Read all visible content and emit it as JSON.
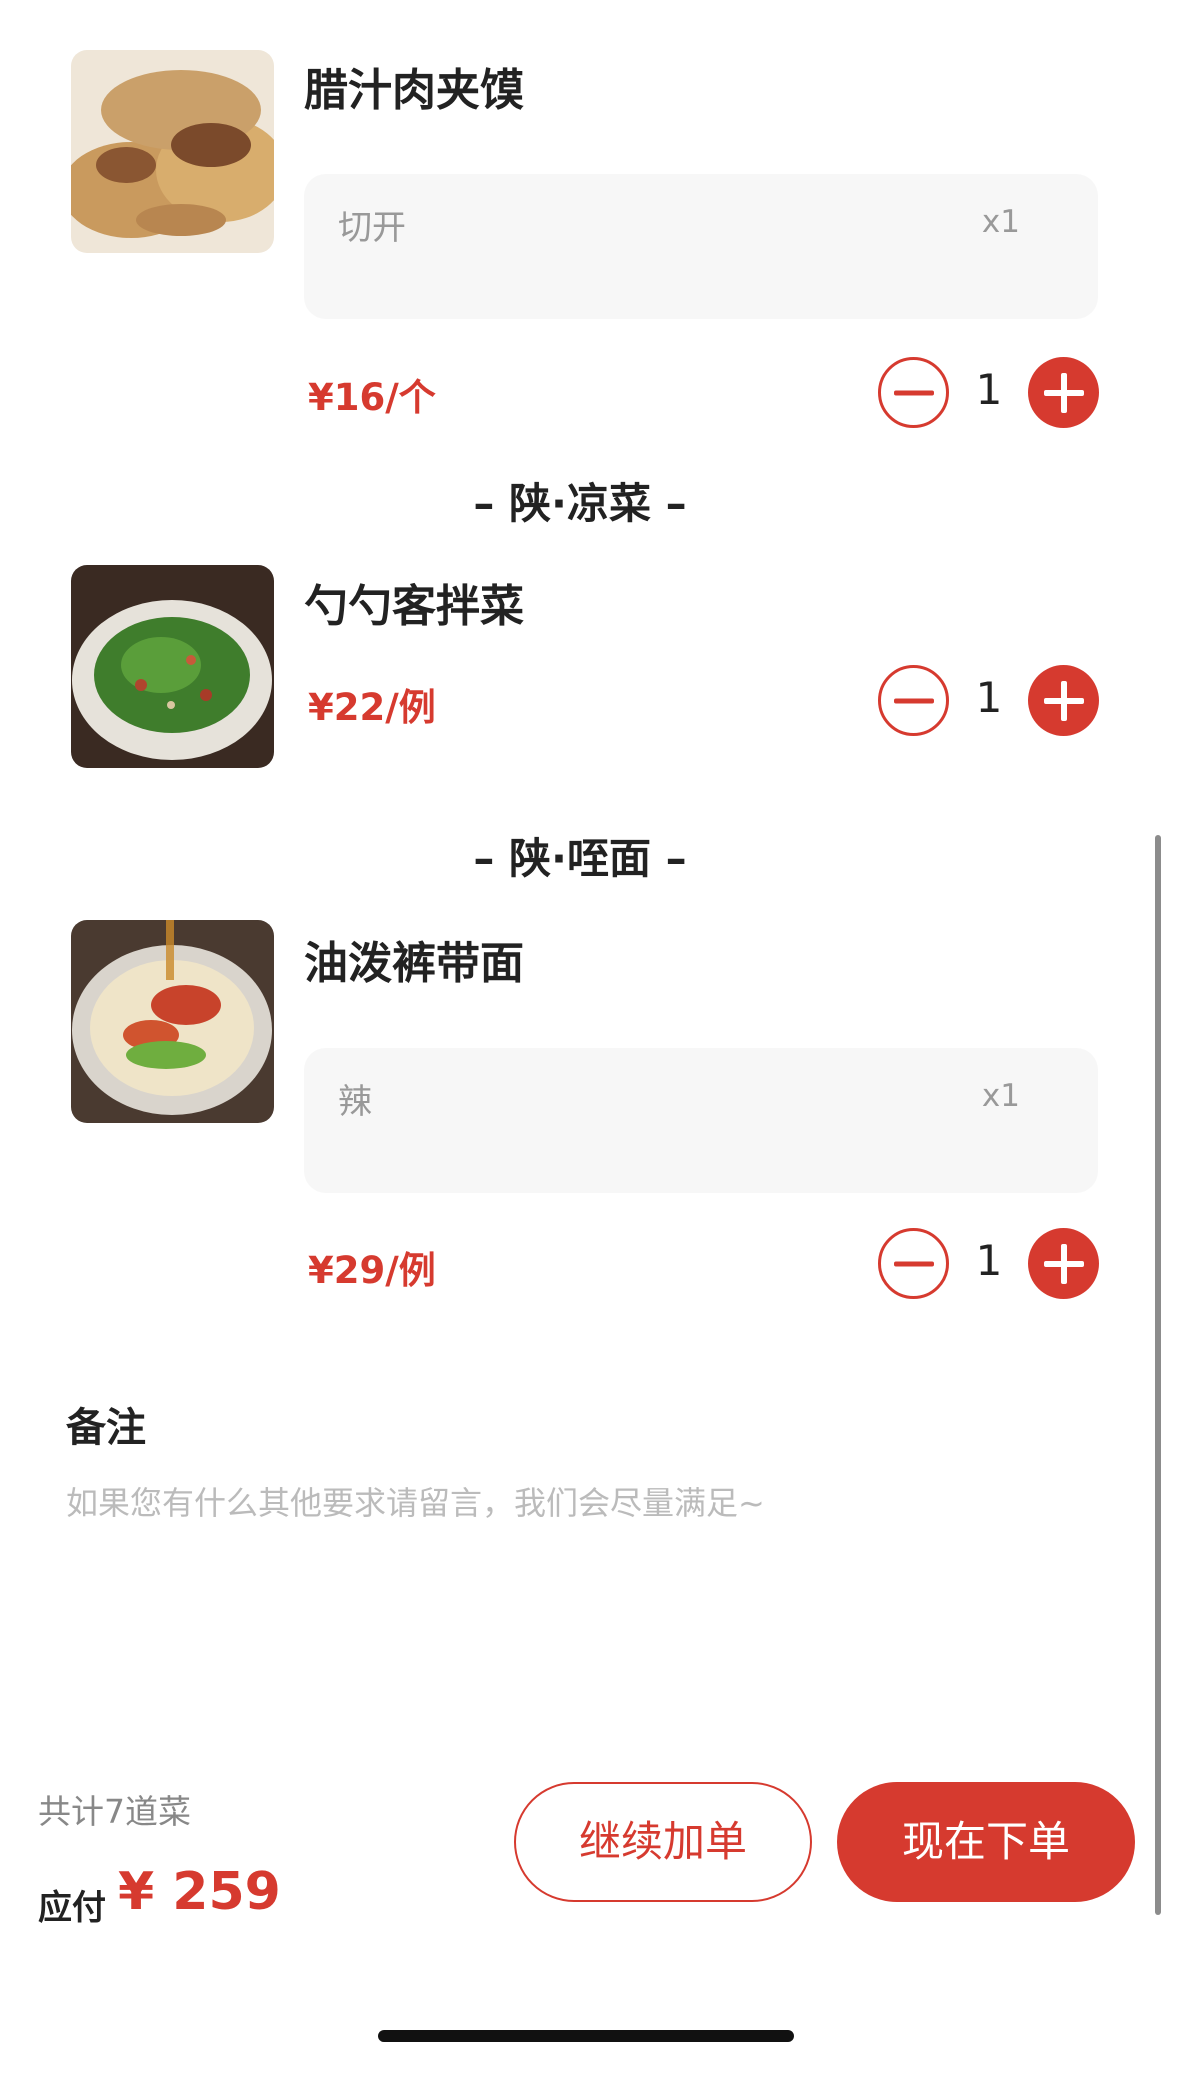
{
  "theme": {
    "accent": "#d63a2f",
    "text": "#222222",
    "muted": "#999999",
    "note_bg": "#f7f7f7"
  },
  "items": [
    {
      "name": "腊汁肉夹馍",
      "note": "切开",
      "note_qty": "x1",
      "price": "¥16/个",
      "qty": "1",
      "image": "roujiamo-photo"
    },
    {
      "name": "勺勺客拌菜",
      "price": "¥22/例",
      "qty": "1",
      "image": "bancai-photo"
    },
    {
      "name": "油泼裤带面",
      "note": "辣",
      "note_qty": "x1",
      "price": "¥29/例",
      "qty": "1",
      "image": "youpo-noodle-photo"
    }
  ],
  "sections": [
    {
      "title": "– 陕·凉菜 –"
    },
    {
      "title": "– 陕·咥面 –"
    }
  ],
  "remark": {
    "title": "备注",
    "placeholder": "如果您有什么其他要求请留言，我们会尽量满足~"
  },
  "footer": {
    "count_text": "共计7道菜",
    "pay_label": "应付",
    "pay_amount": "¥ 259",
    "continue_label": "继续加单",
    "order_label": "现在下单"
  }
}
